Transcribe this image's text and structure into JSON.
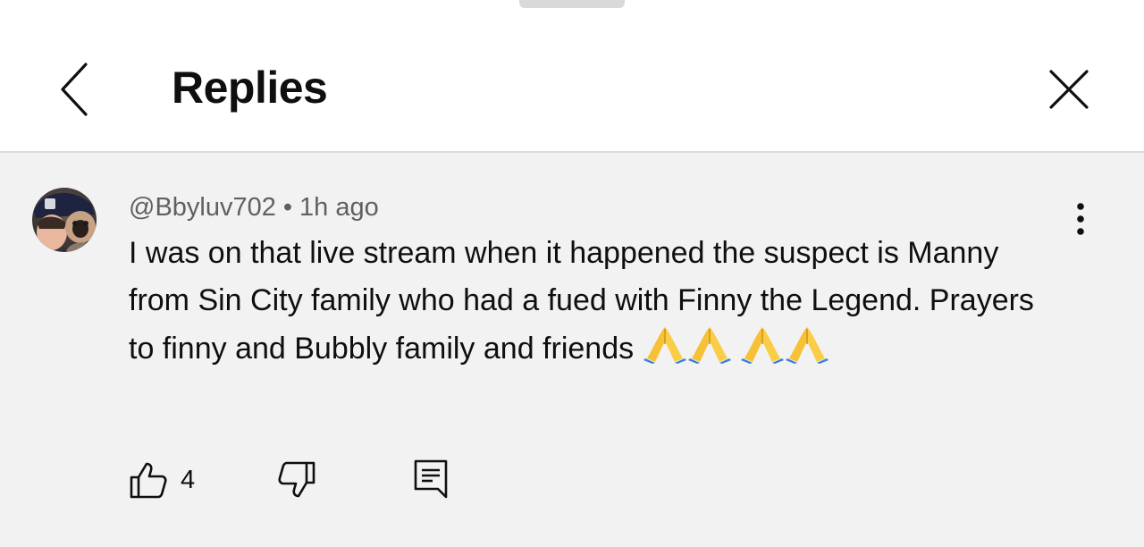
{
  "header": {
    "title": "Replies",
    "icons": {
      "back": "back-chevron-icon",
      "close": "close-icon"
    }
  },
  "comment": {
    "author": "@Bbyluv702",
    "separator": "•",
    "time": "1h ago",
    "text": "I was on that live stream when it happened the suspect is Manny from Sin City family who had a fued with Finny the Legend. Prayers to finny and Bubbly family and friends",
    "emoji_name": "folded-hands-emoji",
    "emoji_count": 4,
    "likes": "4",
    "icons": {
      "avatar": "avatar",
      "more": "more-vertical-icon",
      "like": "thumbs-up-icon",
      "dislike": "thumbs-down-icon",
      "reply": "reply-comment-icon"
    }
  },
  "colors": {
    "header_bg": "#ffffff",
    "body_bg": "#f2f2f2",
    "text": "#0f0f0f",
    "meta_text": "#606060",
    "divider": "#dcdcdc"
  }
}
